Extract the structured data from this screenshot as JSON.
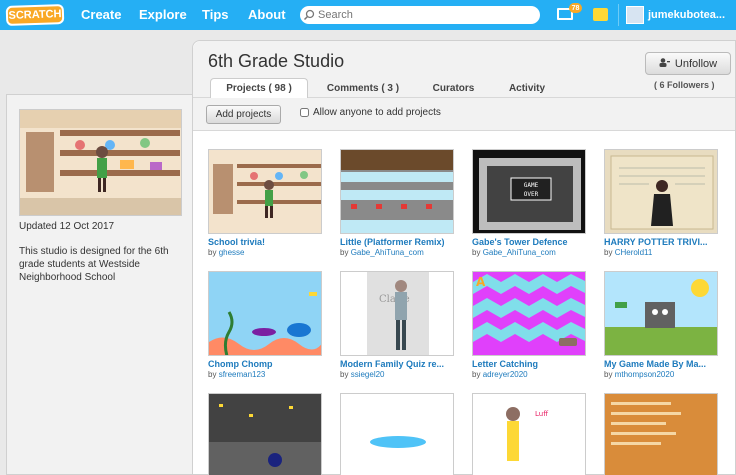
{
  "nav": {
    "logo": "SCRATCH",
    "items": [
      "Create",
      "Explore",
      "Tips",
      "About"
    ],
    "search_placeholder": "Search",
    "message_count": "78",
    "username": "jumekubotea..."
  },
  "studio": {
    "title": "6th Grade Studio",
    "unfollow_label": "Unfollow",
    "followers": "( 6 Followers )",
    "tabs": [
      {
        "label": "Projects ( 98 )"
      },
      {
        "label": "Comments ( 3 )"
      },
      {
        "label": "Curators"
      },
      {
        "label": "Activity"
      }
    ],
    "add_projects_label": "Add projects",
    "allow_label": "Allow anyone to add projects",
    "updated": "Updated 12 Oct 2017",
    "description": "This studio is designed for the 6th grade students at Westside Neighborhood School"
  },
  "by_prefix": "by",
  "projects": [
    {
      "title": "School trivia!",
      "author": "ghesse"
    },
    {
      "title": "Little (Platformer Remix)",
      "author": "Gabe_AhiTuna_com"
    },
    {
      "title": "Gabe's Tower Defence",
      "author": "Gabe_AhiTuna_com"
    },
    {
      "title": "HARRY POTTER TRIVI...",
      "author": "CHerold11"
    },
    {
      "title": "Chomp Chomp",
      "author": "sfreeman123"
    },
    {
      "title": "Modern Family Quiz re...",
      "author": "ssiegel20"
    },
    {
      "title": "Letter Catching",
      "author": "adreyer2020"
    },
    {
      "title": "My Game Made By Ma...",
      "author": "mthompson2020"
    }
  ],
  "thumb_text": {
    "game_over": "GAME OVER",
    "tower_title": "Gabe's Tower Defence",
    "claire": "Claire",
    "letter_a": "A",
    "luff": "Luff"
  },
  "colors": {
    "nav_bg": "#25aff4",
    "link": "#1e7bbd",
    "logo": "#f9a825"
  }
}
